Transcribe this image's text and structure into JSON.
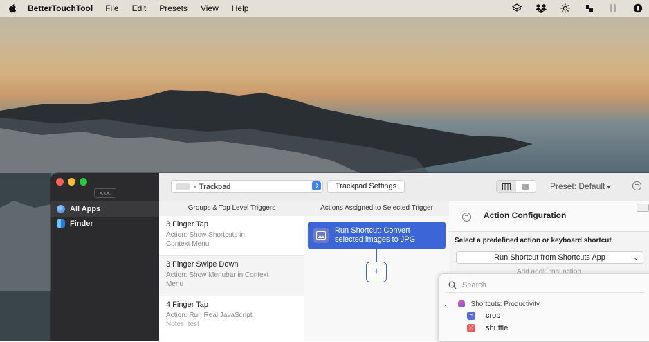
{
  "menubar": {
    "app_name": "BetterTouchTool",
    "menus": [
      "File",
      "Edit",
      "Presets",
      "View",
      "Help"
    ],
    "status_icons": [
      "layers-icon",
      "dropbox-icon",
      "brightness-icon",
      "bettertouchtool-icon",
      "battery-icon",
      "info-icon"
    ]
  },
  "sidebar": {
    "collapse_label": "<<<",
    "items": [
      {
        "label": "All Apps",
        "icon": "globe-icon"
      },
      {
        "label": "Finder",
        "icon": "finder-icon"
      }
    ]
  },
  "toolbar": {
    "device": "Trackpad",
    "settings_button": "Trackpad Settings",
    "preset_label": "Preset: Default"
  },
  "columns": {
    "triggers_header": "Groups & Top Level Triggers",
    "actions_header": "Actions Assigned to Selected Trigger"
  },
  "triggers": [
    {
      "title": "3 Finger Tap",
      "action": "Action: Show Shortcuts in Context Menu",
      "notes": ""
    },
    {
      "title": "3 Finger Swipe Down",
      "action": "Action: Show Menubar in Context Menu",
      "notes": ""
    },
    {
      "title": "4 Finger Tap",
      "action": "Action: Run Real JavaScript",
      "notes": "Notes: test"
    }
  ],
  "assigned_action": {
    "label": "Run Shortcut: Convert selected images to JPG",
    "add_button": "+"
  },
  "config": {
    "title": "Action Configuration",
    "predefined_label": "Select a predefined action or keyboard shortcut",
    "selected_action": "Run Shortcut from Shortcuts App",
    "additional_action_text": "Add additional action"
  },
  "popover": {
    "search_placeholder": "Search",
    "group": "Shortcuts: Productivity",
    "items": [
      {
        "label": "crop",
        "color": "#5b6bd8"
      },
      {
        "label": "shuffle",
        "color": "#e85b5b"
      }
    ]
  },
  "colors": {
    "accent": "#3c66d8",
    "sidebar_bg": "#2b2b2d"
  }
}
